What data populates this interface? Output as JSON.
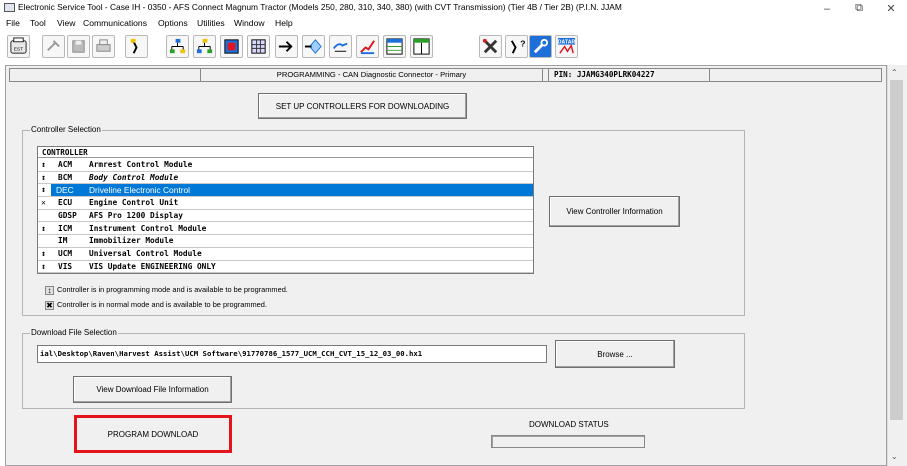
{
  "window": {
    "title": "Electronic Service Tool - Case IH - 0350 - AFS Connect Magnum Tractor (Models 250, 280, 310, 340, 380) (with CVT Transmission) (Tier 4B / Tier 2B) (P.I.N. JJAM",
    "minimize_glyph": "–",
    "maximize_glyph": "⧉",
    "close_glyph": "✕"
  },
  "menu": [
    "File",
    "Tool",
    "View",
    "Communications",
    "Options",
    "Utilities",
    "Window",
    "Help"
  ],
  "toolbar": {
    "icons": [
      "est-icon",
      "connect-icon",
      "save-icon",
      "print-icon",
      "probe-icon",
      "network-icon",
      "network-alt-icon",
      "module-icon",
      "module-grid-icon",
      "arrow-icon",
      "diamond-arrow-icon",
      "hand-icon",
      "signal-icon",
      "data-table-icon",
      "data-table-alt-icon",
      "tools-icon",
      "probe-question-icon",
      "wrench-gear-icon",
      "datar-icon"
    ],
    "datar_label": "DATAR"
  },
  "header": {
    "title": "PROGRAMMING - CAN Diagnostic Connector - Primary",
    "pin": "PIN: JJAMG340PLRK04227"
  },
  "setup_button": "SET UP CONTROLLERS FOR DOWNLOADING",
  "controller_selection": {
    "legend": "Controller Selection",
    "column_header": "CONTROLLER",
    "rows": [
      {
        "mark": "↕",
        "code": "ACM",
        "name": "Armrest Control Module"
      },
      {
        "mark": "↕",
        "code": "BCM",
        "name": "Body Control Module"
      },
      {
        "mark": "↕",
        "code": "DEC",
        "name": "Driveline Electronic Control"
      },
      {
        "mark": "✕",
        "code": "ECU",
        "name": "Engine Control Unit"
      },
      {
        "mark": "",
        "code": "GDSP",
        "name": "AFS Pro 1200 Display"
      },
      {
        "mark": "↕",
        "code": "ICM",
        "name": "Instrument Control Module"
      },
      {
        "mark": "",
        "code": "IM",
        "name": "Immobilizer Module"
      },
      {
        "mark": "↕",
        "code": "UCM",
        "name": "Universal Control Module"
      },
      {
        "mark": "↕",
        "code": "VIS",
        "name": "VIS Update ENGINEERING ONLY"
      }
    ],
    "selected_index": 2,
    "view_info_button": "View Controller Information",
    "legend_programming": "Controller is in programming mode and is available to be programmed.",
    "legend_normal": "Controller is in normal mode and is available to be programmed.",
    "legend_programming_sym": "↕",
    "legend_normal_sym": "✖"
  },
  "download_file": {
    "legend": "Download File Selection",
    "path": "ial\\Desktop\\Raven\\Harvest Assist\\UCM Software\\91770786_1577_UCM_CCH_CVT_15_12_03_00.hx1",
    "browse_button": "Browse ...",
    "view_info_button": "View Download File Information"
  },
  "program_download_button": "PROGRAM DOWNLOAD",
  "download_status": {
    "label": "DOWNLOAD STATUS",
    "progress": 0
  },
  "colors": {
    "selection": "#0078d7",
    "highlight_box": "#e4141c",
    "panel_bg": "#f0f0f0"
  }
}
